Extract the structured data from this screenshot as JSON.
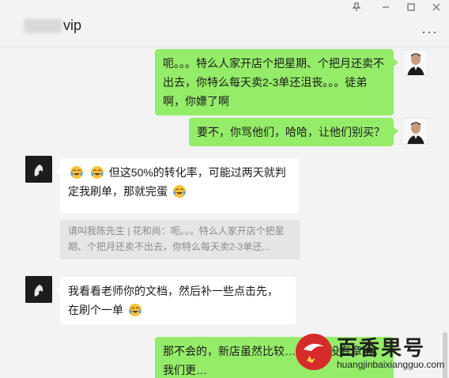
{
  "header": {
    "title": "vip",
    "pin_icon": "pin-icon",
    "minimize_icon": "minimize-icon",
    "maximize_icon": "maximize-icon",
    "close_icon": "close-icon",
    "more_icon": "more-icon"
  },
  "messages": [
    {
      "side": "me",
      "text": "呃。。。特么人家开店个把星期、个把月还卖不出去，你特么每天卖2-3单还沮丧。。。徒弟啊，你嫖了啊"
    },
    {
      "side": "me",
      "text": "要不，你骂他们，哈哈，让他们别买？"
    },
    {
      "side": "other",
      "text_a": "但这50%的转化率，可能过两天就判",
      "text_b": "定我刷单，那就完蛋",
      "emoji": "crying-laughing-emoji"
    },
    {
      "quote": "请叫我陈先生 | 花和尚：呃。。。特么人家开店个把星期、个把月还卖不出去，你特么每天卖2-3单还..."
    },
    {
      "side": "other",
      "text": "我看看老师你的文档，然后补一些点击先，在刷个一单",
      "emoji": "crying-laughing-emoji"
    },
    {
      "side": "me",
      "text": "那不会的，新店虽然比较…的这么没有章法，我们更…"
    }
  ],
  "watermark": {
    "brand": "百香果号",
    "url": "huangjinbaixiangguo.com"
  },
  "colors": {
    "bg": "#f3f3f3",
    "my_bubble": "#95ec69",
    "their_bubble": "#ffffff"
  }
}
